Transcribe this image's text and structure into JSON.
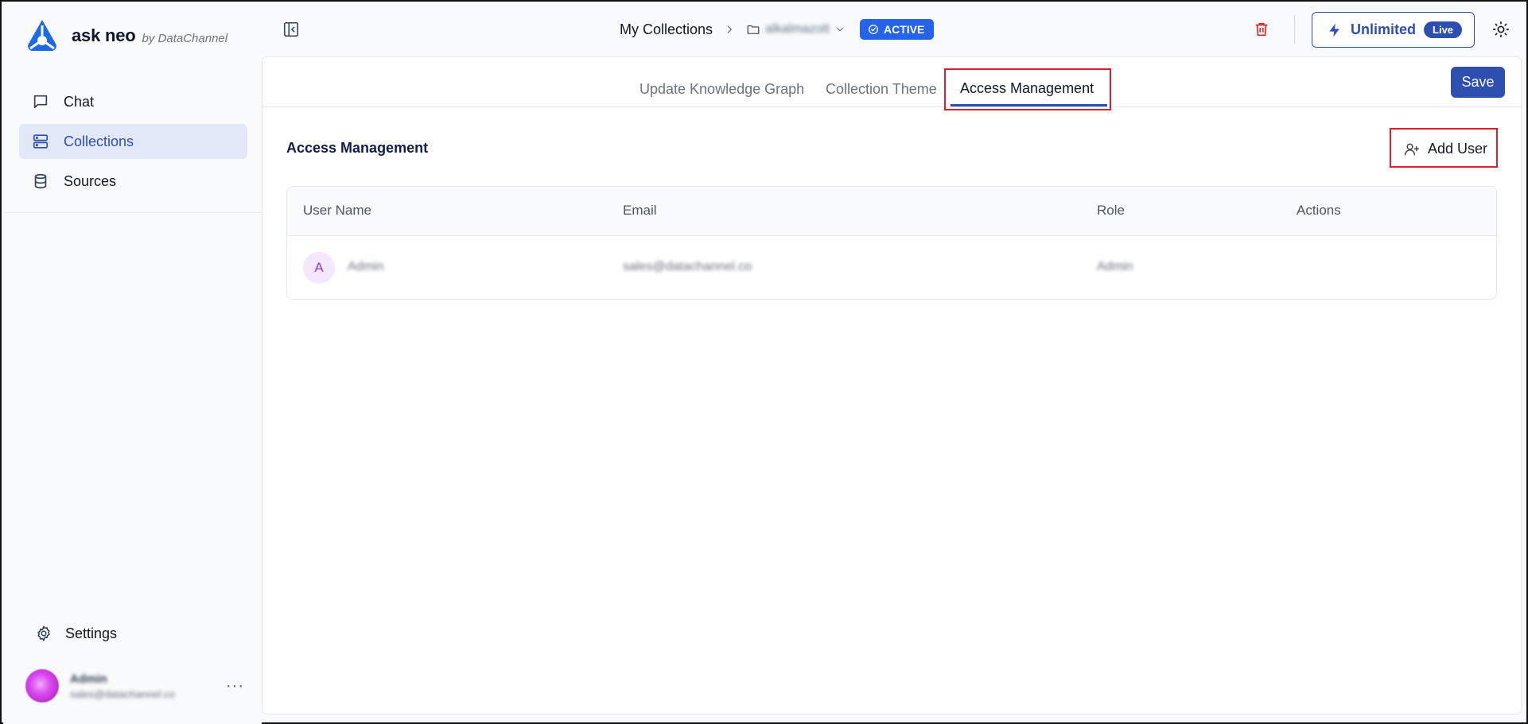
{
  "brand": {
    "name": "ask neo",
    "by": "by DataChannel",
    "logo_icon": "ask-neo-logo"
  },
  "sidebar": {
    "items": [
      {
        "label": "Chat",
        "icon": "chat-icon",
        "active": false
      },
      {
        "label": "Collections",
        "icon": "collections-icon",
        "active": true
      },
      {
        "label": "Sources",
        "icon": "database-icon",
        "active": false
      }
    ],
    "settings_label": "Settings",
    "user": {
      "name": "Admin",
      "email": "sales@datachannel.co"
    },
    "more_label": "···"
  },
  "header": {
    "breadcrumb_root": "My Collections",
    "collection_name": "alkalmazott",
    "status_badge": "ACTIVE",
    "plan_label": "Unlimited",
    "plan_badge": "Live"
  },
  "tabs": [
    {
      "label": "Update Knowledge Graph",
      "active": false
    },
    {
      "label": "Collection Theme",
      "active": false
    },
    {
      "label": "Access Management",
      "active": true
    }
  ],
  "actions": {
    "save_label": "Save",
    "add_user_label": "Add User"
  },
  "section": {
    "title": "Access Management"
  },
  "table": {
    "columns": [
      "User Name",
      "Email",
      "Role",
      "Actions"
    ],
    "rows": [
      {
        "initial": "A",
        "user_name": "Admin",
        "email": "sales@datachannel.co",
        "role": "Admin",
        "actions": ""
      }
    ]
  },
  "colors": {
    "accent": "#2d4fb0",
    "badge": "#2563eb",
    "danger": "#dc2626",
    "highlight": "#e11d2a"
  }
}
